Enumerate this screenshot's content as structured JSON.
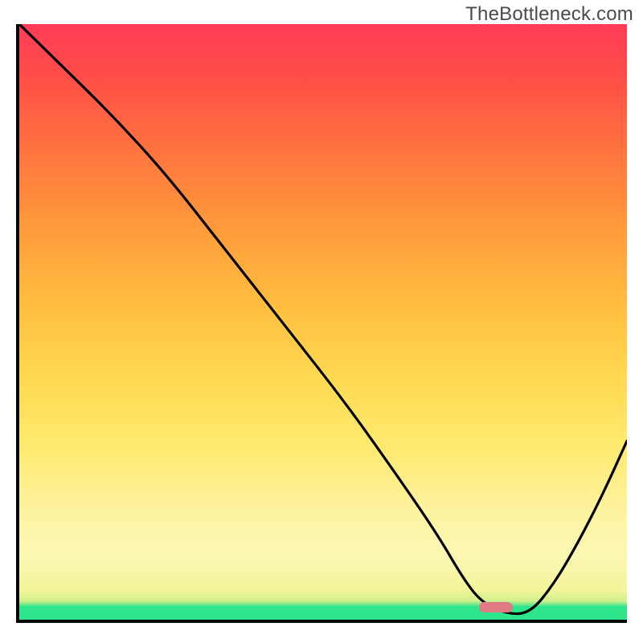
{
  "watermark": "TheBottleneck.com",
  "chart_data": {
    "type": "line",
    "title": "",
    "xlabel": "",
    "ylabel": "",
    "xlim": [
      0,
      100
    ],
    "ylim": [
      0,
      100
    ],
    "grid": false,
    "legend": false,
    "background_gradient": {
      "stops": [
        {
          "pos": 0,
          "color": "#2de58a"
        },
        {
          "pos": 2.2,
          "color": "#2de58a"
        },
        {
          "pos": 3.2,
          "color": "#d2f08e"
        },
        {
          "pos": 11,
          "color": "#fbf7b4"
        },
        {
          "pos": 30,
          "color": "#ffe96c"
        },
        {
          "pos": 54,
          "color": "#ffbb3f"
        },
        {
          "pos": 78,
          "color": "#ff763e"
        },
        {
          "pos": 100,
          "color": "#ff3b57"
        }
      ],
      "direction": "bottom-to-top"
    },
    "series": [
      {
        "name": "bottleneck-curve",
        "color": "#000000",
        "x": [
          0,
          6,
          15,
          24,
          34,
          44,
          54,
          63,
          69,
          73,
          76,
          80,
          84,
          88,
          92,
          96,
          100
        ],
        "y": [
          100,
          94,
          85,
          75,
          62,
          49,
          36,
          23,
          14,
          7,
          3,
          1,
          1,
          6,
          13,
          21,
          30
        ]
      }
    ],
    "marker": {
      "shape": "rounded-bar",
      "color": "#e07b84",
      "x_center": 78,
      "y": 2,
      "width_pct": 5.5
    }
  }
}
